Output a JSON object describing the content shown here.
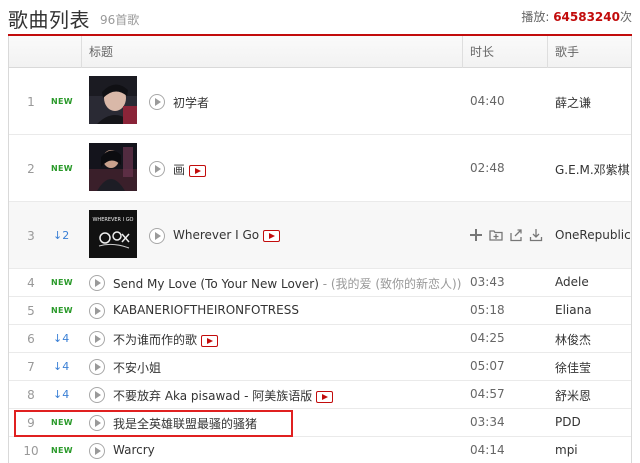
{
  "header": {
    "title": "歌曲列表",
    "count": "96首歌",
    "plays_label": "播放:",
    "plays_value": "64583240",
    "plays_unit": "次"
  },
  "columns": {
    "title": "标题",
    "duration": "时长",
    "artist": "歌手"
  },
  "colors": {
    "accent": "#c20c0c",
    "new_badge": "#2b9a2b",
    "rank_up": "#3a7fd5",
    "highlight": "#e02020"
  },
  "rows": [
    {
      "rank": "1",
      "badge": "NEW",
      "title": "初学者",
      "subtitle": "",
      "mv": false,
      "duration": "04:40",
      "artist": "薛之谦",
      "cover": true
    },
    {
      "rank": "2",
      "badge": "NEW",
      "title": "画",
      "subtitle": "",
      "mv": true,
      "duration": "02:48",
      "artist": "G.E.M.邓紫棋",
      "cover": true
    },
    {
      "rank": "3",
      "badge": "↓2",
      "title": "Wherever I Go",
      "subtitle": "",
      "mv": true,
      "duration": "",
      "artist": "OneRepublic",
      "cover": true,
      "cover_text": "WHEREVER I GO"
    },
    {
      "rank": "4",
      "badge": "NEW",
      "title": "Send My Love (To Your New Lover)",
      "subtitle": " - (我的爱 (致你的新恋人))",
      "mv": false,
      "duration": "03:43",
      "artist": "Adele"
    },
    {
      "rank": "5",
      "badge": "NEW",
      "title": "KABANERIOFTHEIRONFOTRESS",
      "subtitle": "",
      "mv": false,
      "duration": "05:18",
      "artist": "Eliana"
    },
    {
      "rank": "6",
      "badge": "↓4",
      "title": "不为谁而作的歌",
      "subtitle": "",
      "mv": true,
      "duration": "04:25",
      "artist": "林俊杰"
    },
    {
      "rank": "7",
      "badge": "↓4",
      "title": "不安小姐",
      "subtitle": "",
      "mv": false,
      "duration": "05:07",
      "artist": "徐佳莹"
    },
    {
      "rank": "8",
      "badge": "↓4",
      "title": "不要放弃 Aka pisawad - 阿美族语版",
      "subtitle": "",
      "mv": true,
      "duration": "04:57",
      "artist": "舒米恩"
    },
    {
      "rank": "9",
      "badge": "NEW",
      "title": "我是全英雄联盟最骚的骚猪",
      "subtitle": "",
      "mv": false,
      "duration": "03:34",
      "artist": "PDD"
    },
    {
      "rank": "10",
      "badge": "NEW",
      "title": "Warcry",
      "subtitle": "",
      "mv": false,
      "duration": "04:14",
      "artist": "mpi"
    }
  ],
  "row_actions": [
    "add-icon",
    "add-to-playlist-icon",
    "share-icon",
    "download-icon"
  ]
}
